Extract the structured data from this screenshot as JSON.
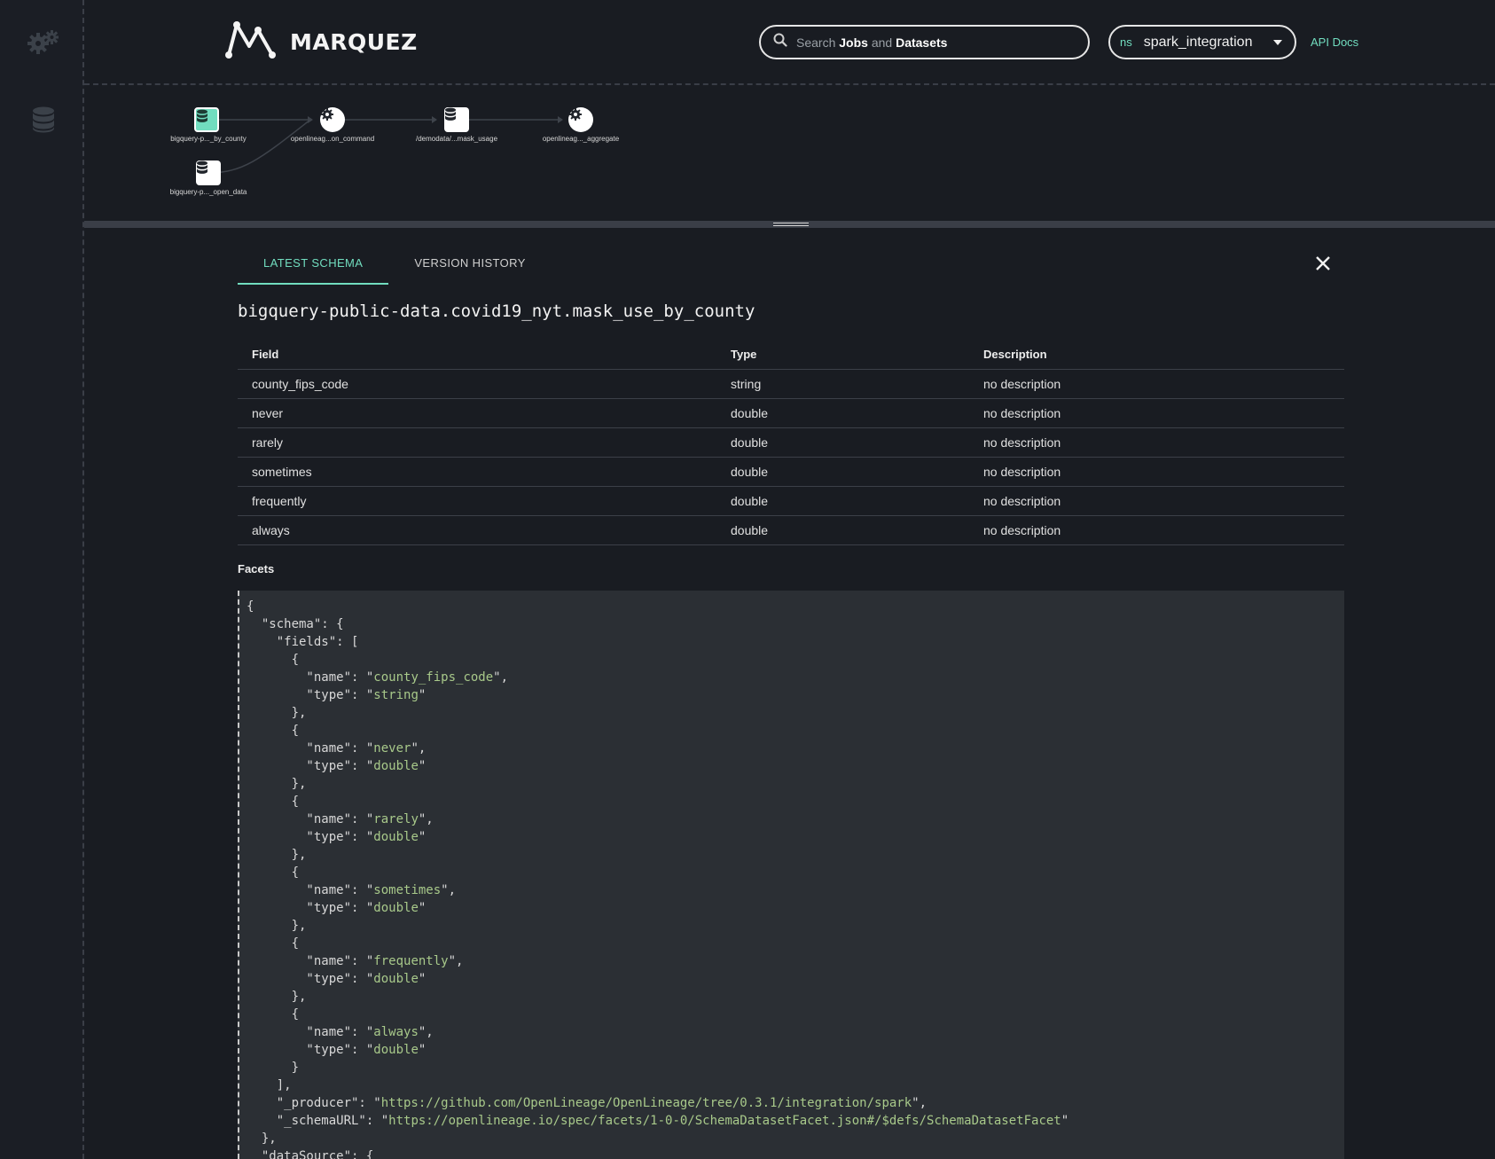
{
  "app": {
    "name": "MARQUEZ"
  },
  "colors": {
    "accent": "#71ddbf",
    "background": "#191c22",
    "json_string": "#a8c98a"
  },
  "sidebar": {
    "items": [
      {
        "icon": "gear-icon"
      },
      {
        "icon": "database-icon"
      }
    ]
  },
  "header": {
    "search": {
      "prefix": "Search",
      "jobs": "Jobs",
      "and": "and",
      "datasets": "Datasets"
    },
    "namespace": {
      "prefix": "ns",
      "value": "spark_integration"
    },
    "api_docs": "API Docs"
  },
  "lineage": {
    "nodes": [
      {
        "label": "bigquery-p..._by_county",
        "kind": "dataset",
        "selected": true
      },
      {
        "label": "openlineag...on_command",
        "kind": "job"
      },
      {
        "label": "/demodata/...mask_usage",
        "kind": "dataset"
      },
      {
        "label": "openlineag..._aggregate",
        "kind": "job"
      },
      {
        "label": "bigquery-p..._open_data",
        "kind": "dataset"
      }
    ]
  },
  "details": {
    "tabs": [
      {
        "label": "LATEST SCHEMA",
        "active": true
      },
      {
        "label": "VERSION HISTORY",
        "active": false
      }
    ],
    "dataset_name": "bigquery-public-data.covid19_nyt.mask_use_by_county",
    "table": {
      "headers": [
        "Field",
        "Type",
        "Description"
      ],
      "rows": [
        [
          "county_fips_code",
          "string",
          "no description"
        ],
        [
          "never",
          "double",
          "no description"
        ],
        [
          "rarely",
          "double",
          "no description"
        ],
        [
          "sometimes",
          "double",
          "no description"
        ],
        [
          "frequently",
          "double",
          "no description"
        ],
        [
          "always",
          "double",
          "no description"
        ]
      ]
    },
    "facets_label": "Facets",
    "facets_json": {
      "fields": [
        {
          "name": "county_fips_code",
          "type": "string"
        },
        {
          "name": "never",
          "type": "double"
        },
        {
          "name": "rarely",
          "type": "double"
        },
        {
          "name": "sometimes",
          "type": "double"
        },
        {
          "name": "frequently",
          "type": "double"
        },
        {
          "name": "always",
          "type": "double"
        }
      ],
      "producer": "https://github.com/OpenLineage/OpenLineage/tree/0.3.1/integration/spark",
      "schema_url": "https://openlineage.io/spec/facets/1-0-0/SchemaDatasetFacet.json#/$defs/SchemaDatasetFacet"
    }
  }
}
